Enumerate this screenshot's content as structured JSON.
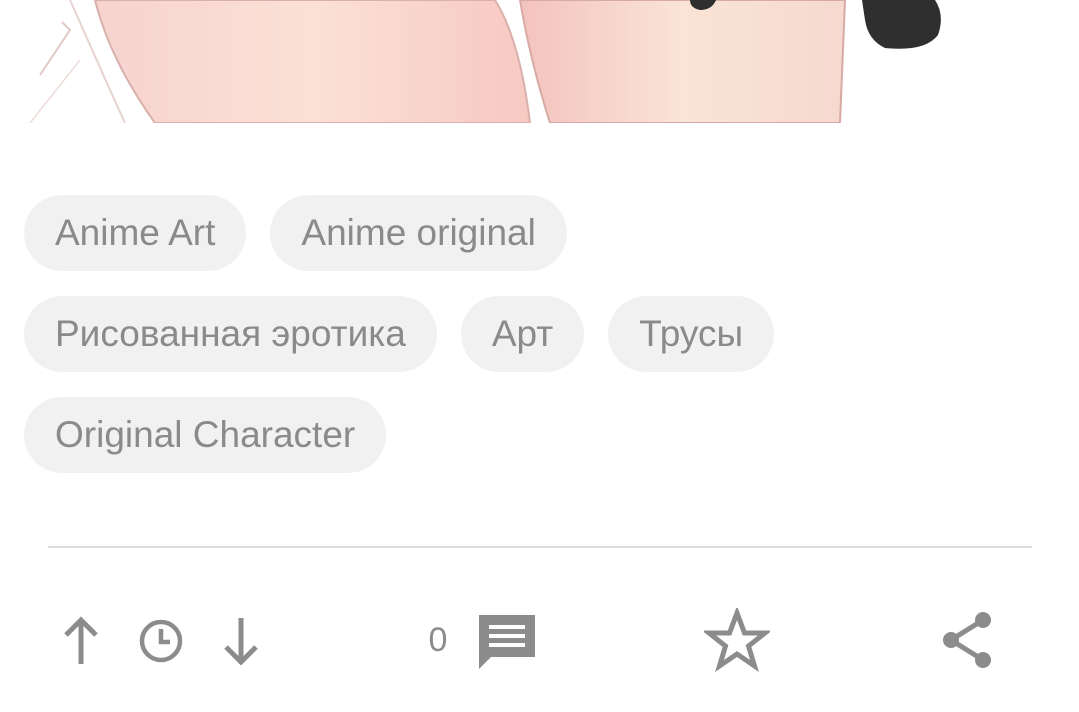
{
  "post": {
    "image_alt": "post-illustration"
  },
  "tags": [
    [
      "Anime Art",
      "Anime original"
    ],
    [
      "Рисованная эротика",
      "Арт",
      "Трусы"
    ],
    [
      "Original Character"
    ]
  ],
  "actions": {
    "upvote_icon": "arrow-up-icon",
    "history_icon": "clock-icon",
    "downvote_icon": "arrow-down-icon",
    "comments_count": "0",
    "comments_icon": "comment-icon",
    "favorite_icon": "star-outline-icon",
    "share_icon": "share-icon"
  },
  "colors": {
    "tag_bg": "#f1f1f1",
    "tag_text": "#8a8a8a",
    "icon": "#8c8c8c",
    "divider": "#dcdcdc"
  }
}
